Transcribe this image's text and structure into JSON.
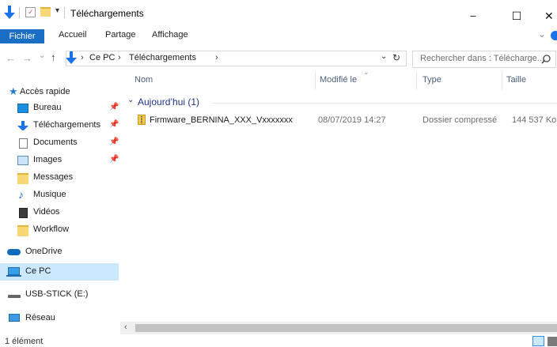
{
  "window": {
    "title": "Téléchargements",
    "controls": {
      "minimize": "–",
      "maximize": "☐",
      "close": "✕"
    }
  },
  "ribbon": {
    "tabs": [
      "Fichier",
      "Accueil",
      "Partage",
      "Affichage"
    ],
    "chevron": "⌄"
  },
  "address": {
    "breadcrumb": [
      "Ce PC",
      "Téléchargements"
    ],
    "separator": "›",
    "search_placeholder": "Rechercher dans : Télécharge..."
  },
  "sidebar": {
    "quick_access": "Accès rapide",
    "pinned": [
      {
        "label": "Bureau",
        "icon": "desktop-icon",
        "pinned": true
      },
      {
        "label": "Téléchargements",
        "icon": "download-icon",
        "pinned": true
      },
      {
        "label": "Documents",
        "icon": "documents-icon",
        "pinned": true
      },
      {
        "label": "Images",
        "icon": "images-icon",
        "pinned": true
      },
      {
        "label": "Messages",
        "icon": "folder-icon",
        "pinned": false
      },
      {
        "label": "Musique",
        "icon": "music-icon",
        "pinned": false
      },
      {
        "label": "Vidéos",
        "icon": "videos-icon",
        "pinned": false
      },
      {
        "label": "Workflow",
        "icon": "folder-icon",
        "pinned": false
      }
    ],
    "onedrive": "OneDrive",
    "this_pc": "Ce PC",
    "usb": "USB-STICK (E:)",
    "network": "Réseau"
  },
  "columns": {
    "name": "Nom",
    "modified": "Modifié le",
    "type": "Type",
    "size": "Taille"
  },
  "group": {
    "label": "Aujourd’hui (1)"
  },
  "files": [
    {
      "name": "Firmware_BERNINA_XXX_Vxxxxxxx",
      "modified": "08/07/2019 14:27",
      "type": "Dossier compressé",
      "size": "144 537 Ko"
    }
  ],
  "status": {
    "count": "1 élément"
  },
  "colors": {
    "accent": "#1a6fc4",
    "selected": "#cce8ff",
    "header_text": "#4c607a",
    "group_text": "#1e3287"
  }
}
